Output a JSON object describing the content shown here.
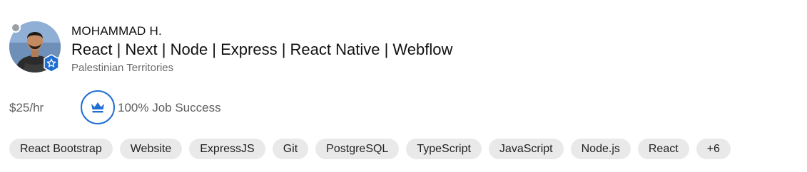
{
  "profile": {
    "name": "MOHAMMAD H.",
    "headline": "React | Next | Node | Express | React Native | Webflow",
    "location": "Palestinian Territories",
    "rate": "$25/hr",
    "job_success": "100% Job Success",
    "status_color": "#9aa0a6",
    "badge_color": "#1f6ed4",
    "badge_icon": "star-badge-icon",
    "success_icon": "crown-icon"
  },
  "skills": [
    "React Bootstrap",
    "Website",
    "ExpressJS",
    "Git",
    "PostgreSQL",
    "TypeScript",
    "JavaScript",
    "Node.js",
    "React",
    "+6"
  ]
}
